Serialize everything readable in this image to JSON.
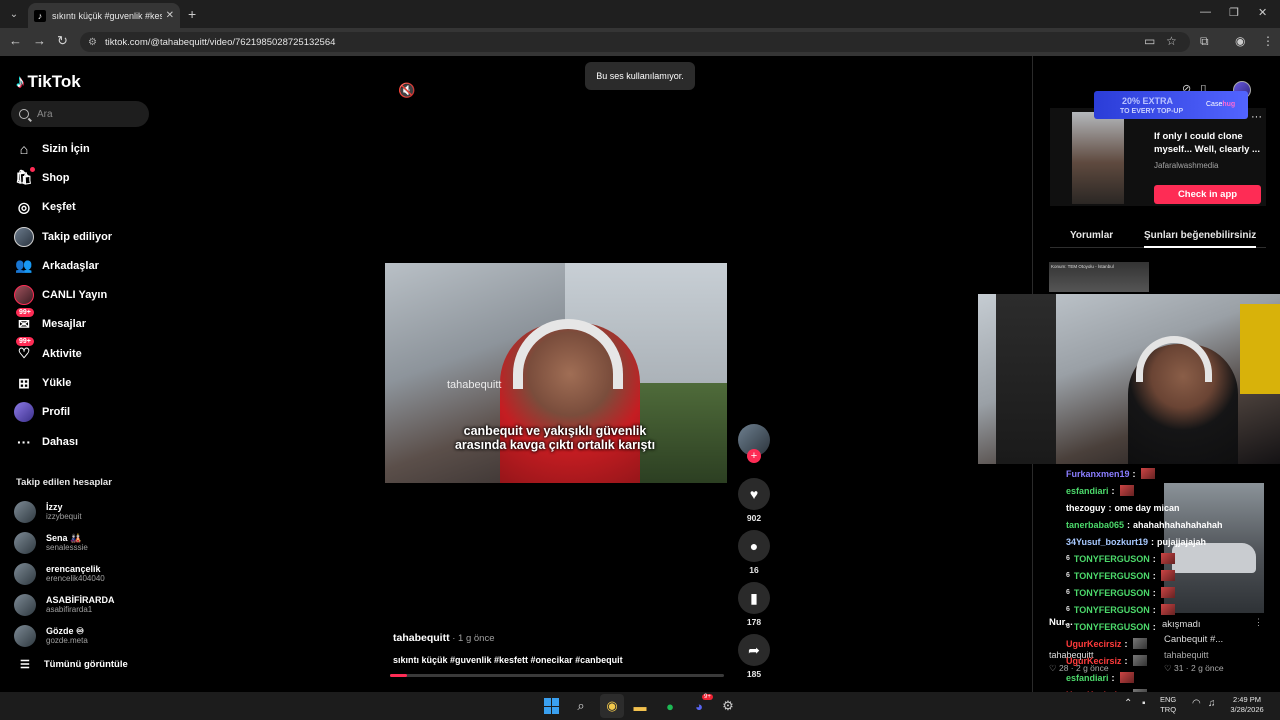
{
  "browser": {
    "tab_title": "sıkıntı küçük #guvenlik #kesfett",
    "tab_close": "✕",
    "new_tab": "+",
    "url": "tiktok.com/@tahabequitt/video/7621985028725132564",
    "window_controls": [
      "—",
      "❐",
      "✕"
    ]
  },
  "sidebar": {
    "logo": "TikTok",
    "search_placeholder": "Ara",
    "nav": [
      {
        "label": "Sizin İçin",
        "icon": "home-icon",
        "glyph": "⌂"
      },
      {
        "label": "Shop",
        "icon": "shop-icon",
        "glyph": "🛍"
      },
      {
        "label": "Keşfet",
        "icon": "compass-icon",
        "glyph": "◎"
      },
      {
        "label": "Takip ediliyor",
        "icon": "following-avatar"
      },
      {
        "label": "Arkadaşlar",
        "icon": "friends-icon",
        "glyph": "👥"
      },
      {
        "label": "CANLI Yayın",
        "icon": "live-avatar"
      },
      {
        "label": "Mesajlar",
        "icon": "messages-icon",
        "glyph": "✉",
        "badge": "99+"
      },
      {
        "label": "Aktivite",
        "icon": "activity-icon",
        "glyph": "♡",
        "badge": "99+"
      },
      {
        "label": "Yükle",
        "icon": "upload-icon",
        "glyph": "⊞"
      },
      {
        "label": "Profil",
        "icon": "profile-avatar"
      },
      {
        "label": "Dahası",
        "icon": "more-icon",
        "glyph": "···"
      }
    ],
    "following_title": "Takip edilen hesaplar",
    "following": [
      {
        "name": "İzzy",
        "handle": "izzybequit"
      },
      {
        "name": "Sena 🎎",
        "handle": "senalesssie"
      },
      {
        "name": "erencançelik",
        "handle": "erencelik404040"
      },
      {
        "name": "ASABİFİRARDA",
        "handle": "asabifirarda1"
      },
      {
        "name": "Gözde ♾",
        "handle": "gozde.meta"
      }
    ],
    "see_all": "Tümünü görüntüle"
  },
  "video": {
    "toast": "Bu ses kullanılamıyor.",
    "watermark": "tahabequitt",
    "caption": "canbequit ve yakışıklı güvenlik arasında kavga çıktı ortalık karıştı",
    "author": "tahabequitt",
    "posted": " · 1 g önce",
    "description": "sıkıntı küçük #guvenlik #kesfett #onecikar #canbequit",
    "progress": 0.05
  },
  "actions": {
    "likes": "902",
    "comments": "16",
    "saves": "178",
    "shares": "185"
  },
  "right_panel": {
    "promo_line1": "20% EXTRA",
    "promo_line2": "TO EVERY TOP-UP",
    "promo_brand": "Case",
    "promo_brand_accent": "hug",
    "ad_title": "If only I could clone myself... Well, clearly ...",
    "ad_source": "Jafaralwashmedia",
    "ad_cta": "Check in app",
    "tab_comments": "Yorumlar",
    "tab_recommended": "Şunları beğenebilirsiniz",
    "mini_thumb_text": "Konum: TEM Otoyolu - İstanbul",
    "clip_caption": "Canbequit #...",
    "card1_title": "Nur...",
    "card1_extra": "akışmadı",
    "card1_author": "tahabequitt",
    "card1_meta": "♡ 28 · 2 g önce",
    "card2_title": "Canbequit #...",
    "card2_author": "tahabequitt",
    "card2_meta": "♡ 31 · 2 g önce"
  },
  "chat": [
    {
      "user": "Furkanxmen19",
      "color": "#8a7dff",
      "text": "",
      "emote": true
    },
    {
      "user": "esfandiari",
      "color": "#4cd96b",
      "text": "",
      "emote": true
    },
    {
      "user": "thezoguy",
      "color": "#ffffff",
      "text": "ome day mican",
      "emote": false
    },
    {
      "user": "tanerbaba065",
      "color": "#4cd96b",
      "text": "ahahahhahahahahah",
      "emote": false
    },
    {
      "user": "34Yusuf_bozkurt19",
      "color": "#a8c9ff",
      "text": "pujajjajajah",
      "emote": false
    },
    {
      "user": "TONYFERGUSON",
      "color": "#4cd96b",
      "text": "",
      "emote": true,
      "prefix": "6"
    },
    {
      "user": "TONYFERGUSON",
      "color": "#4cd96b",
      "text": "",
      "emote": true,
      "prefix": "6"
    },
    {
      "user": "TONYFERGUSON",
      "color": "#4cd96b",
      "text": "",
      "emote": true,
      "prefix": "6"
    },
    {
      "user": "TONYFERGUSON",
      "color": "#4cd96b",
      "text": "",
      "emote": true,
      "prefix": "6"
    },
    {
      "user": "TONYFERGUSON",
      "color": "#4cd96b",
      "text": "",
      "emote": false,
      "prefix": "6"
    },
    {
      "user": "UgurKecirsiz",
      "color": "#ff3b3b",
      "text": "",
      "emote": true
    },
    {
      "user": "UgurKecirsiz",
      "color": "#ff3b3b",
      "text": "",
      "emote": true
    },
    {
      "user": "esfandiari",
      "color": "#4cd96b",
      "text": "",
      "emote": true
    },
    {
      "user": "UgurKecirsiz",
      "color": "#ff3b3b",
      "text": "",
      "emote": true
    },
    {
      "user": "UgurKecirsiz",
      "color": "#ff3b3b",
      "text": "",
      "emote": true
    }
  ],
  "taskbar": {
    "lang": "ENG",
    "region": "TRQ",
    "time": "2:49 PM",
    "date": "3/28/2026",
    "discord_badge": "9+"
  }
}
